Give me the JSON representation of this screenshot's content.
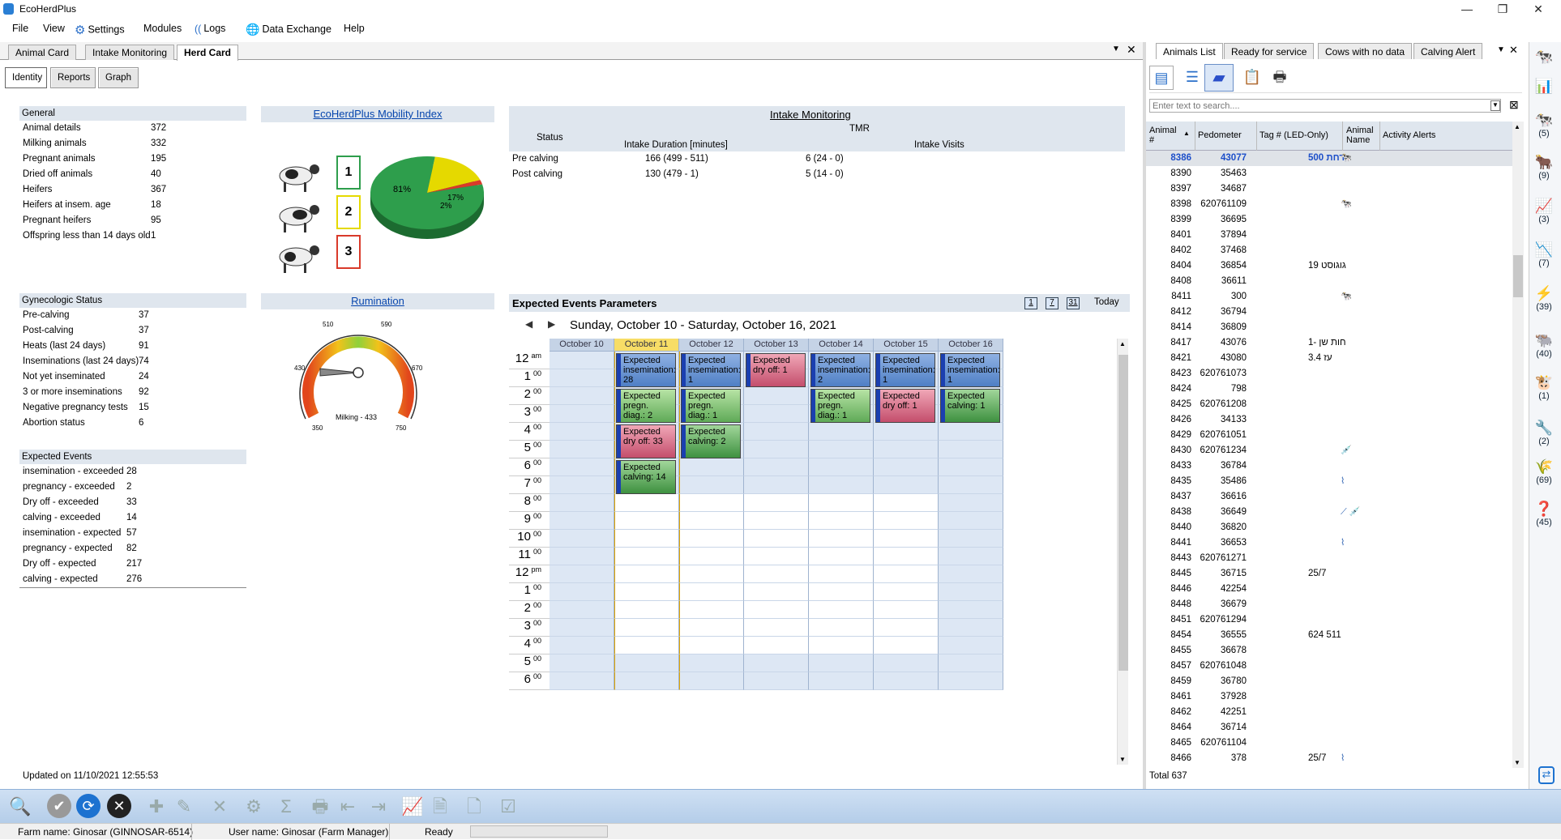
{
  "window": {
    "title": "EcoHerdPlus",
    "minimize": "—",
    "restore": "❐",
    "close": "✕"
  },
  "menu": {
    "file": "File",
    "view": "View",
    "settings": "Settings",
    "modules": "Modules",
    "logs": "Logs",
    "data_exchange": "Data Exchange",
    "help": "Help"
  },
  "left_tabs": [
    "Animal Card",
    "Intake Monitoring",
    "Herd Card"
  ],
  "sub_tabs": [
    "Identity",
    "Reports",
    "Graph"
  ],
  "general": {
    "title": "General",
    "rows": [
      {
        "label": "Animal details",
        "value": "372"
      },
      {
        "label": "Milking animals",
        "value": "332"
      },
      {
        "label": "Pregnant animals",
        "value": "195"
      },
      {
        "label": "Dried off animals",
        "value": "40"
      },
      {
        "label": "Heifers",
        "value": "367"
      },
      {
        "label": "Heifers at insem. age",
        "value": "18"
      },
      {
        "label": "Pregnant heifers",
        "value": "95"
      },
      {
        "label": "Offspring less than 14 days old",
        "value": "1"
      }
    ]
  },
  "gyneco": {
    "title": "Gynecologic Status",
    "rows": [
      {
        "label": "Pre-calving",
        "value": "37"
      },
      {
        "label": "Post-calving",
        "value": "37"
      },
      {
        "label": "Heats (last 24 days)",
        "value": "91"
      },
      {
        "label": "Inseminations (last 24 days)",
        "value": "74"
      },
      {
        "label": "Not yet inseminated",
        "value": "24"
      },
      {
        "label": "3 or more inseminations",
        "value": "92"
      },
      {
        "label": "Negative pregnancy tests",
        "value": "15"
      },
      {
        "label": "Abortion status",
        "value": "6"
      }
    ]
  },
  "expected_events": {
    "title": "Expected Events",
    "rows": [
      {
        "label": "insemination - exceeded",
        "value": "28"
      },
      {
        "label": "pregnancy - exceeded",
        "value": "2"
      },
      {
        "label": "Dry off - exceeded",
        "value": "33"
      },
      {
        "label": "calving - exceeded",
        "value": "14"
      },
      {
        "label": "insemination - expected",
        "value": "57"
      },
      {
        "label": "pregnancy - expected",
        "value": "82"
      },
      {
        "label": "Dry off - expected",
        "value": "217"
      },
      {
        "label": "calving - expected",
        "value": "276"
      }
    ]
  },
  "updated": "Updated on 11/10/2021 12:55:53",
  "mobility": {
    "title": "EcoHerdPlus Mobility Index",
    "levels": [
      "1",
      "2",
      "3"
    ],
    "colors": {
      "green": "#2e9e4c",
      "yellow": "#e5d900",
      "red": "#d93a2a"
    },
    "pie": {
      "green_pct": 81,
      "yellow_pct": 17,
      "red_pct": 2,
      "labels": [
        "81%",
        "17%",
        "2%"
      ]
    }
  },
  "rumination": {
    "title": "Rumination",
    "gauge_ticks": [
      "350",
      "430",
      "510",
      "590",
      "670",
      "750"
    ],
    "value": 433,
    "label": "Milking - 433"
  },
  "intake": {
    "title": "Intake Monitoring",
    "tmr": "TMR",
    "status_header": "Status",
    "duration_header": "Intake Duration [minutes]",
    "visits_header": "Intake Visits",
    "rows": [
      {
        "status": "Pre calving",
        "duration": "166  (499 - 511)",
        "visits": "6  (24 - 0)"
      },
      {
        "status": "Post calving",
        "duration": "130  (479 - 1)",
        "visits": "5  (14 - 0)"
      }
    ]
  },
  "calendar": {
    "title": "Expected Events Parameters",
    "view_buttons": [
      "1",
      "7",
      "31"
    ],
    "today": "Today",
    "range": "Sunday, October 10 - Saturday, October 16, 2021",
    "days": [
      "October 10",
      "October 11",
      "October 12",
      "October 13",
      "October 14",
      "October 15",
      "October 16"
    ],
    "hours": [
      {
        "h": "12",
        "m": "am"
      },
      {
        "h": "1",
        "m": "00"
      },
      {
        "h": "2",
        "m": "00"
      },
      {
        "h": "3",
        "m": "00"
      },
      {
        "h": "4",
        "m": "00"
      },
      {
        "h": "5",
        "m": "00"
      },
      {
        "h": "6",
        "m": "00"
      },
      {
        "h": "7",
        "m": "00"
      },
      {
        "h": "8",
        "m": "00"
      },
      {
        "h": "9",
        "m": "00"
      },
      {
        "h": "10",
        "m": "00"
      },
      {
        "h": "11",
        "m": "00"
      },
      {
        "h": "12",
        "m": "pm"
      },
      {
        "h": "1",
        "m": "00"
      },
      {
        "h": "2",
        "m": "00"
      },
      {
        "h": "3",
        "m": "00"
      },
      {
        "h": "4",
        "m": "00"
      },
      {
        "h": "5",
        "m": "00"
      },
      {
        "h": "6",
        "m": "00"
      }
    ],
    "events": [
      {
        "day": 1,
        "slot": 0,
        "len": 2,
        "color": "blue",
        "text": "Expected insemination: 28"
      },
      {
        "day": 1,
        "slot": 2,
        "len": 2,
        "color": "green",
        "text": "Expected pregn. diag.: 2"
      },
      {
        "day": 1,
        "slot": 4,
        "len": 2,
        "color": "red",
        "text": "Expected dry off: 33"
      },
      {
        "day": 1,
        "slot": 6,
        "len": 2,
        "color": "dgreen",
        "text": "Expected calving: 14"
      },
      {
        "day": 2,
        "slot": 0,
        "len": 2,
        "color": "blue",
        "text": "Expected insemination: 1"
      },
      {
        "day": 2,
        "slot": 2,
        "len": 2,
        "color": "green",
        "text": "Expected pregn. diag.: 1"
      },
      {
        "day": 2,
        "slot": 4,
        "len": 2,
        "color": "dgreen",
        "text": "Expected calving: 2"
      },
      {
        "day": 3,
        "slot": 0,
        "len": 2,
        "color": "red",
        "text": "Expected dry off: 1"
      },
      {
        "day": 4,
        "slot": 0,
        "len": 2,
        "color": "blue",
        "text": "Expected insemination: 2"
      },
      {
        "day": 4,
        "slot": 2,
        "len": 2,
        "color": "green",
        "text": "Expected pregn. diag.: 1"
      },
      {
        "day": 5,
        "slot": 0,
        "len": 2,
        "color": "blue",
        "text": "Expected insemination: 1"
      },
      {
        "day": 5,
        "slot": 2,
        "len": 2,
        "color": "red",
        "text": "Expected dry off: 1"
      },
      {
        "day": 6,
        "slot": 0,
        "len": 2,
        "color": "blue",
        "text": "Expected insemination: 1"
      },
      {
        "day": 6,
        "slot": 2,
        "len": 2,
        "color": "dgreen",
        "text": "Expected calving: 1"
      }
    ]
  },
  "right_tabs": [
    "Animals List",
    "Ready for service",
    "Cows with no data",
    "Calving Alert"
  ],
  "search": {
    "placeholder": "Enter text to search...."
  },
  "animals_table": {
    "headers": [
      "Animal #",
      "Pedometer",
      "Tag # (LED-Only)",
      "Animal Name",
      "Activity Alerts"
    ],
    "rows": [
      {
        "id": "8386",
        "ped": "43077",
        "name": "500 רחת",
        "alert": "cow-icon"
      },
      {
        "id": "8390",
        "ped": "35463",
        "name": "",
        "alert": ""
      },
      {
        "id": "8397",
        "ped": "34687",
        "name": "",
        "alert": ""
      },
      {
        "id": "8398",
        "ped": "620761109",
        "name": "",
        "alert": "cow-icon"
      },
      {
        "id": "8399",
        "ped": "36695",
        "name": "",
        "alert": ""
      },
      {
        "id": "8401",
        "ped": "37894",
        "name": "",
        "alert": ""
      },
      {
        "id": "8402",
        "ped": "37468",
        "name": "",
        "alert": ""
      },
      {
        "id": "8404",
        "ped": "36854",
        "name": "גוגוסט 19",
        "alert": ""
      },
      {
        "id": "8408",
        "ped": "36611",
        "name": "",
        "alert": ""
      },
      {
        "id": "8411",
        "ped": "300",
        "name": "",
        "alert": "cow-icon"
      },
      {
        "id": "8412",
        "ped": "36794",
        "name": "",
        "alert": ""
      },
      {
        "id": "8414",
        "ped": "36809",
        "name": "",
        "alert": ""
      },
      {
        "id": "8417",
        "ped": "43076",
        "name": "חות שן -1",
        "alert": ""
      },
      {
        "id": "8421",
        "ped": "43080",
        "name": "עז 3.4",
        "alert": ""
      },
      {
        "id": "8423",
        "ped": "620761073",
        "name": "",
        "alert": ""
      },
      {
        "id": "8424",
        "ped": "798",
        "name": "",
        "alert": ""
      },
      {
        "id": "8425",
        "ped": "620761208",
        "name": "",
        "alert": ""
      },
      {
        "id": "8426",
        "ped": "34133",
        "name": "",
        "alert": ""
      },
      {
        "id": "8429",
        "ped": "620761051",
        "name": "",
        "alert": ""
      },
      {
        "id": "8430",
        "ped": "620761234",
        "name": "",
        "alert": "syringe-icon"
      },
      {
        "id": "8433",
        "ped": "36784",
        "name": "",
        "alert": ""
      },
      {
        "id": "8435",
        "ped": "35486",
        "name": "",
        "alert": "pulse-icon"
      },
      {
        "id": "8437",
        "ped": "36616",
        "name": "",
        "alert": ""
      },
      {
        "id": "8438",
        "ped": "36649",
        "name": "",
        "alert": "chart-syringe-icon"
      },
      {
        "id": "8440",
        "ped": "36820",
        "name": "",
        "alert": ""
      },
      {
        "id": "8441",
        "ped": "36653",
        "name": "",
        "alert": "pulse-icon"
      },
      {
        "id": "8443",
        "ped": "620761271",
        "name": "",
        "alert": ""
      },
      {
        "id": "8445",
        "ped": "36715",
        "name": "25/7",
        "alert": ""
      },
      {
        "id": "8446",
        "ped": "42254",
        "name": "",
        "alert": ""
      },
      {
        "id": "8448",
        "ped": "36679",
        "name": "",
        "alert": ""
      },
      {
        "id": "8451",
        "ped": "620761294",
        "name": "",
        "alert": ""
      },
      {
        "id": "8454",
        "ped": "36555",
        "name": "624 511",
        "alert": ""
      },
      {
        "id": "8455",
        "ped": "36678",
        "name": "",
        "alert": ""
      },
      {
        "id": "8457",
        "ped": "620761048",
        "name": "",
        "alert": ""
      },
      {
        "id": "8459",
        "ped": "36780",
        "name": "",
        "alert": ""
      },
      {
        "id": "8461",
        "ped": "37928",
        "name": "",
        "alert": ""
      },
      {
        "id": "8462",
        "ped": "42251",
        "name": "",
        "alert": ""
      },
      {
        "id": "8464",
        "ped": "36714",
        "name": "",
        "alert": ""
      },
      {
        "id": "8465",
        "ped": "620761104",
        "name": "",
        "alert": ""
      },
      {
        "id": "8466",
        "ped": "378",
        "name": "25/7",
        "alert": "pulse-icon"
      }
    ],
    "total": "Total  637"
  },
  "sidebar_counts": [
    "(5)",
    "(9)",
    "(3)",
    "(7)",
    "(39)",
    "(40)",
    "(1)",
    "(2)",
    "(69)",
    "(45)"
  ],
  "status": {
    "farm": "Farm name: Ginosar (GINNOSAR-6514)",
    "user": "User name: Ginosar (Farm Manager)",
    "state": "Ready"
  }
}
